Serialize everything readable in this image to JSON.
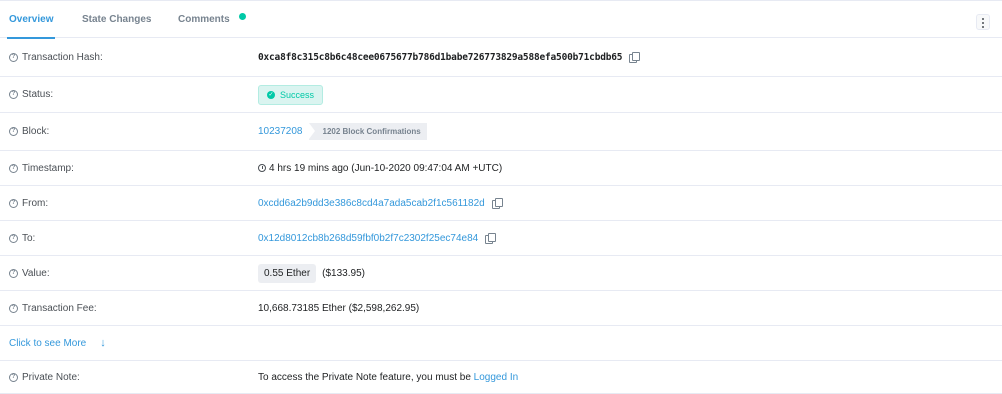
{
  "tabs": [
    {
      "label": "Overview",
      "active": true
    },
    {
      "label": "State Changes"
    },
    {
      "label": "Comments"
    }
  ],
  "rows": {
    "tx_hash": {
      "label": "Transaction Hash:",
      "value": "0xca8f8c315c8b6c48cee0675677b786d1babe726773829a588efa500b71cbdb65"
    },
    "status": {
      "label": "Status:",
      "value": "Success"
    },
    "block": {
      "label": "Block:",
      "value": "10237208",
      "confirmations": "1202 Block Confirmations"
    },
    "timestamp": {
      "label": "Timestamp:",
      "value": "4 hrs 19 mins ago (Jun-10-2020 09:47:04 AM +UTC)"
    },
    "from": {
      "label": "From:",
      "value": "0xcdd6a2b9dd3e386c8cd4a7ada5cab2f1c561182d"
    },
    "to": {
      "label": "To:",
      "value": "0x12d8012cb8b268d59fbf0b2f7c2302f25ec74e84"
    },
    "value": {
      "label": "Value:",
      "ether": "0.55 Ether",
      "usd": "($133.95)"
    },
    "fee": {
      "label": "Transaction Fee:",
      "value": "10,668.73185 Ether ($2,598,262.95)"
    },
    "private_note": {
      "label": "Private Note:",
      "text": "To access the Private Note feature, you must be",
      "link": "Logged In"
    }
  },
  "see_more": "Click to see More",
  "colors": {
    "accent": "#3498db",
    "success": "#00c9a7",
    "border": "#e7eaf3"
  },
  "icons": {
    "question": "question-circle-icon",
    "copy": "copy-icon",
    "clock": "clock-icon",
    "check": "check-circle-icon",
    "arrow": "arrow-down-icon",
    "menu": "kebab-menu-icon"
  }
}
